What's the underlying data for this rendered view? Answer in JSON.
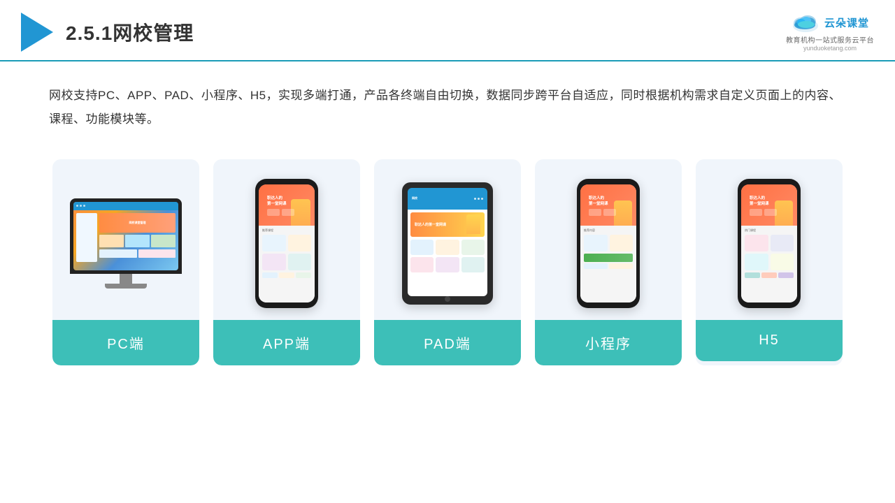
{
  "header": {
    "title_prefix": "2.5.1",
    "title_main": "网校管理",
    "logo_text": "云朵课堂",
    "logo_url": "yunduoketang.com",
    "logo_tagline": "教育机构一站式服务云平台"
  },
  "description": {
    "text": "网校支持PC、APP、PAD、小程序、H5，实现多端打通，产品各终端自由切换，数据同步跨平台自适应，同时根据机构需求自定义页面上的内容、课程、功能模块等。"
  },
  "cards": [
    {
      "id": "pc",
      "label": "PC端"
    },
    {
      "id": "app",
      "label": "APP端"
    },
    {
      "id": "pad",
      "label": "PAD端"
    },
    {
      "id": "miniapp",
      "label": "小程序"
    },
    {
      "id": "h5",
      "label": "H5"
    }
  ],
  "colors": {
    "accent_blue": "#2196d3",
    "accent_teal": "#3dbfb8",
    "header_border": "#1a9cb7"
  }
}
